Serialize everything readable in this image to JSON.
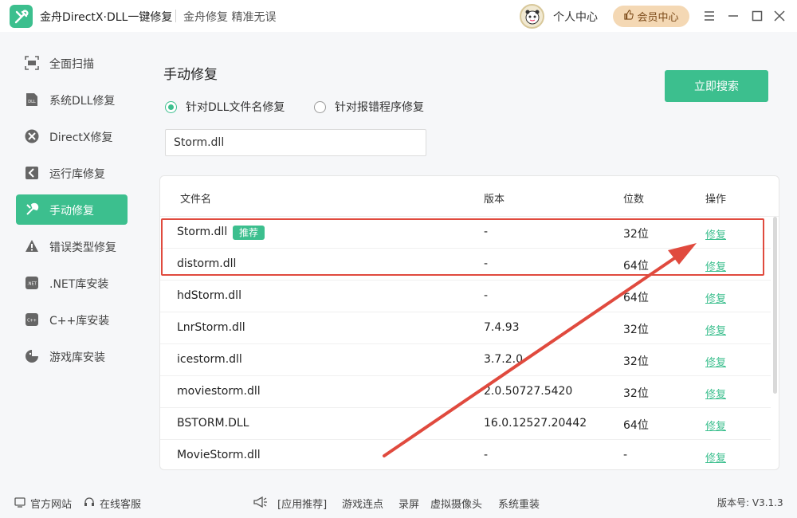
{
  "app": {
    "title": "金舟DirectX·DLL一键修复",
    "slogan": "金舟修复 精准无误",
    "user_center": "个人中心",
    "vip_label": "会员中心"
  },
  "sidebar": {
    "items": [
      {
        "label": "全面扫描",
        "icon": "scan-icon"
      },
      {
        "label": "系统DLL修复",
        "icon": "dll-icon"
      },
      {
        "label": "DirectX修复",
        "icon": "directx-icon"
      },
      {
        "label": "运行库修复",
        "icon": "runtime-icon"
      },
      {
        "label": "手动修复",
        "icon": "wrench-icon",
        "active": true
      },
      {
        "label": "错误类型修复",
        "icon": "warning-icon"
      },
      {
        "label": ".NET库安装",
        "icon": "dotnet-icon"
      },
      {
        "label": "C++库安装",
        "icon": "cpp-icon"
      },
      {
        "label": "游戏库安装",
        "icon": "game-icon"
      }
    ]
  },
  "main": {
    "title": "手动修复",
    "search_button": "立即搜索",
    "radio_options": [
      {
        "label": "针对DLL文件名修复",
        "checked": true
      },
      {
        "label": "针对报错程序修复",
        "checked": false
      }
    ],
    "search_value": "Storm.dll",
    "table": {
      "headers": [
        "文件名",
        "版本",
        "位数",
        "操作"
      ],
      "recommend_badge": "推荐",
      "action_label": "修复",
      "rows": [
        {
          "name": "Storm.dll",
          "version": "-",
          "bits": "32位",
          "recommended": true
        },
        {
          "name": "distorm.dll",
          "version": "-",
          "bits": "64位"
        },
        {
          "name": "hdStorm.dll",
          "version": "-",
          "bits": "64位"
        },
        {
          "name": "LnrStorm.dll",
          "version": "7.4.93",
          "bits": "32位"
        },
        {
          "name": "icestorm.dll",
          "version": "3.7.2.0",
          "bits": "32位"
        },
        {
          "name": "moviestorm.dll",
          "version": "2.0.50727.5420",
          "bits": "32位"
        },
        {
          "name": "BSTORM.DLL",
          "version": "16.0.12527.20442",
          "bits": "64位"
        },
        {
          "name": "MovieStorm.dll",
          "version": "-",
          "bits": "-"
        }
      ]
    }
  },
  "footer": {
    "official_site": "官方网站",
    "online_service": "在线客服",
    "recommend_label": "[应用推荐]",
    "links": [
      "游戏连点",
      "录屏",
      "虚拟摄像头",
      "系统重装"
    ],
    "version": "版本号: V3.1.3"
  },
  "colors": {
    "accent": "#3cbf8e",
    "highlight": "#e04a3e",
    "vip_bg": "#f4d8b4"
  }
}
